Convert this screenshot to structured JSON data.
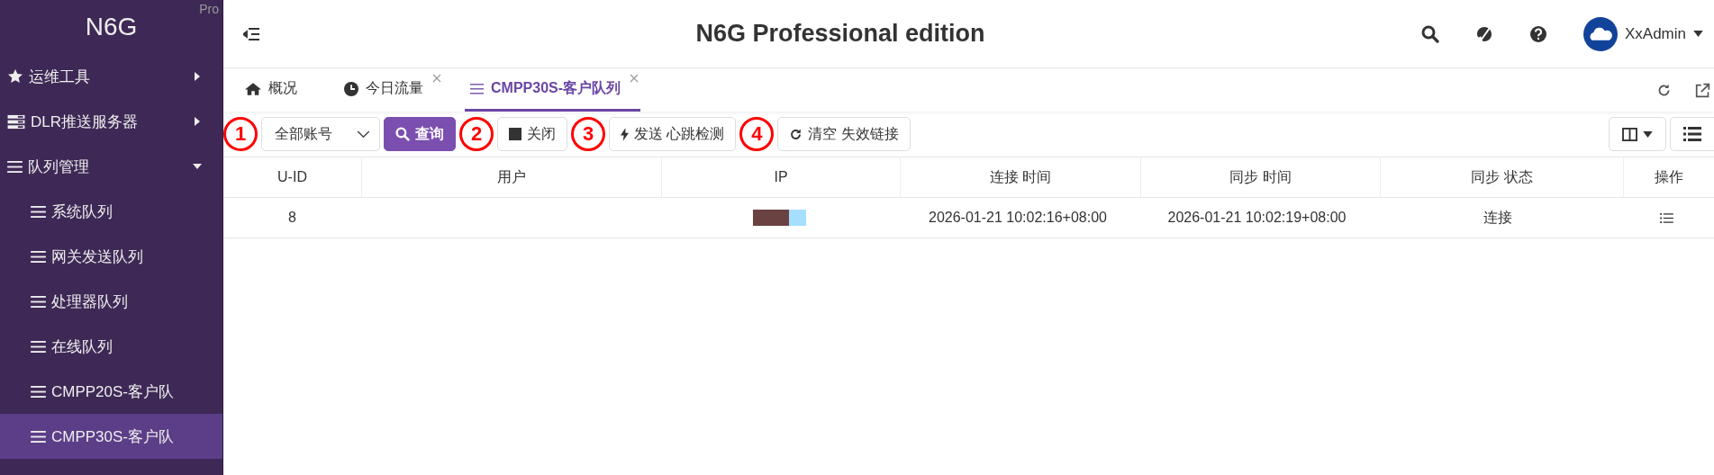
{
  "sidebar": {
    "logo": "N6G",
    "edition_badge": "Pro",
    "items": [
      {
        "label": "运维工具",
        "kind": "star",
        "expanded": false,
        "selected": false
      },
      {
        "label": "DLR推送服务器",
        "kind": "server",
        "expanded": false,
        "selected": false
      },
      {
        "label": "队列管理",
        "kind": "list",
        "expanded": true,
        "selected": false,
        "children": [
          {
            "label": "系统队列",
            "selected": false
          },
          {
            "label": "网关发送队列",
            "selected": false
          },
          {
            "label": "处理器队列",
            "selected": false
          },
          {
            "label": "在线队列",
            "selected": false
          },
          {
            "label": "CMPP20S-客户队",
            "selected": false
          },
          {
            "label": "CMPP30S-客户队",
            "selected": true
          }
        ]
      }
    ]
  },
  "header": {
    "title": "N6G Professional edition",
    "user": "XxAdmin"
  },
  "tabs": [
    {
      "label": "概况",
      "kind": "home",
      "closable": false,
      "selected": false
    },
    {
      "label": "今日流量",
      "kind": "clock",
      "closable": true,
      "selected": false
    },
    {
      "label": "CMPP30S-客户队列",
      "kind": "list",
      "closable": true,
      "selected": true
    }
  ],
  "toolbar": {
    "account_select": {
      "value": "全部账号"
    },
    "buttons": [
      {
        "label": "查询",
        "kind": "search"
      },
      {
        "label": "关闭",
        "kind": "stop"
      },
      {
        "label": "发送 心跳检测",
        "kind": "send"
      },
      {
        "label": "清空 失效链接",
        "kind": "refresh"
      }
    ]
  },
  "annotations": [
    {
      "label": "1"
    },
    {
      "label": "2"
    },
    {
      "label": "3"
    },
    {
      "label": "4"
    }
  ],
  "table": {
    "columns": [
      "U-ID",
      "用户",
      "IP",
      "连接 时间",
      "同步 时间",
      "同步 状态",
      "操作"
    ],
    "rows": [
      {
        "u_id": "8",
        "connect_time": "2026-01-21 10:02:16+08:00",
        "sync_time": "2026-01-21 10:02:19+08:00",
        "sync_status": "连接"
      }
    ]
  }
}
